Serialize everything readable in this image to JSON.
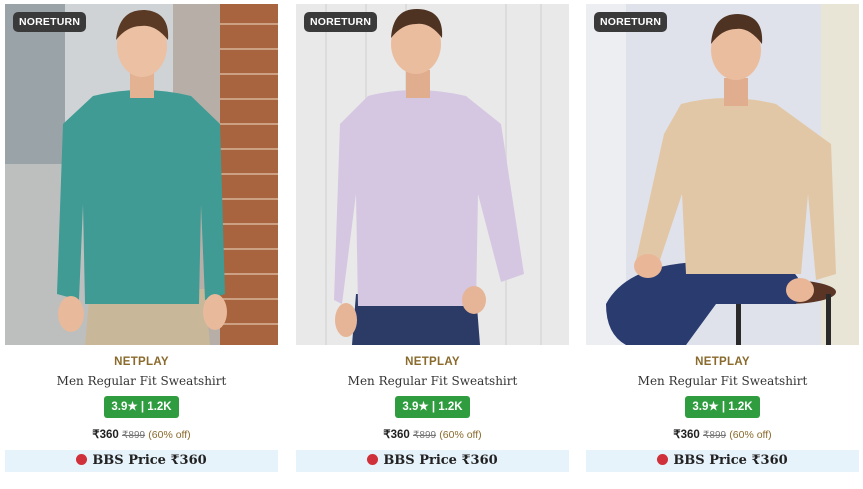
{
  "products": [
    {
      "badge": "NORETURN",
      "brand": "NETPLAY",
      "title": "Men Regular Fit Sweatshirt",
      "rating": "3.9★ | 1.2K",
      "price": "₹360",
      "mrp": "₹899",
      "discount": "(60% off)",
      "bbs_price": "BBS Price ₹360",
      "bbs_icon": "bbs-logo-icon",
      "color": "#3f9b94"
    },
    {
      "badge": "NORETURN",
      "brand": "NETPLAY",
      "title": "Men Regular Fit Sweatshirt",
      "rating": "3.9★ | 1.2K",
      "price": "₹360",
      "mrp": "₹899",
      "discount": "(60% off)",
      "bbs_price": "BBS Price ₹360",
      "bbs_icon": "bbs-logo-icon",
      "color": "#d5c7e2"
    },
    {
      "badge": "NORETURN",
      "brand": "NETPLAY",
      "title": "Men Regular Fit Sweatshirt",
      "rating": "3.9★ | 1.2K",
      "price": "₹360",
      "mrp": "₹899",
      "discount": "(60% off)",
      "bbs_price": "BBS Price ₹360",
      "bbs_icon": "bbs-logo-icon",
      "color": "#e2c7a6"
    }
  ]
}
